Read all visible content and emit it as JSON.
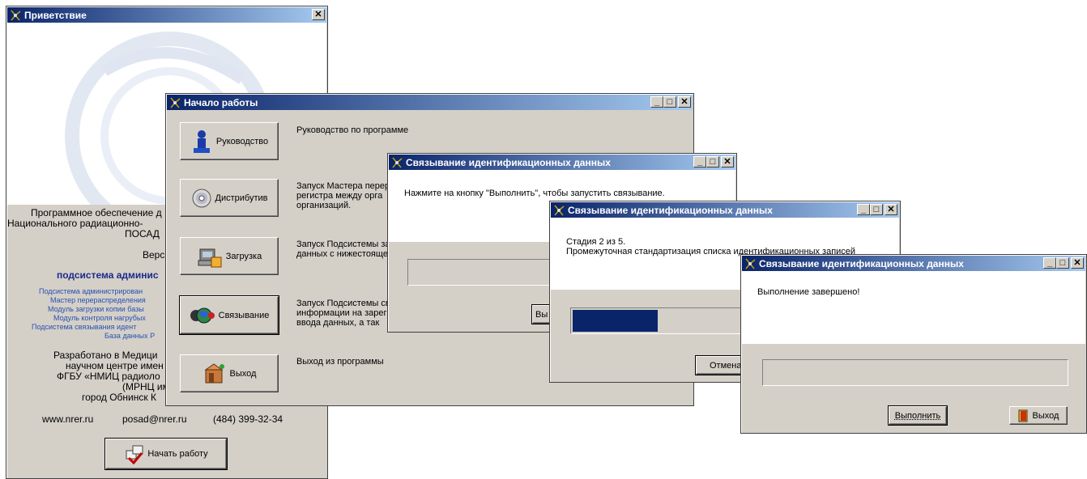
{
  "welcome": {
    "title": "Приветствие",
    "lines": [
      "Программное обеспечение д",
      "Национального радиационно-",
      "ПОСАД",
      "Верс"
    ],
    "subsystem": "подсистема админис",
    "modules": [
      "Подсистема администрирован",
      "Мастер перераспределения",
      "Модуль загрузки копии базы",
      "Модуль контроля нагрубых",
      "Подсистема связывания идент",
      "База данных Р"
    ],
    "dev_lines": [
      "Разработано в Медици",
      "научном центре имен",
      "ФГБУ «НМИЦ радиоло",
      "(МРНЦ им.",
      "город Обнинск К"
    ],
    "site": "www.nrer.ru",
    "email": "posad@nrer.ru",
    "phone": "(484) 399-32-34",
    "start_button": "Начать работу"
  },
  "start": {
    "title": "Начало работы",
    "items": [
      {
        "label": "Руководство",
        "desc": [
          "Руководство по программе"
        ]
      },
      {
        "label": "Дистрибутив",
        "desc": [
          "Запуск Мастера перер",
          "регистра между орга",
          "организаций."
        ]
      },
      {
        "label": "Загрузка",
        "desc": [
          "Запуск Подсистемы за",
          "данных с нижестояще"
        ]
      },
      {
        "label": "Связывание",
        "desc": [
          "Запуск Подсистемы св",
          "информации на зарег",
          "ввода данных, а так"
        ]
      },
      {
        "label": "Выход",
        "desc": [
          "Выход из программы"
        ]
      }
    ]
  },
  "link1": {
    "title": "Связывание идентификационных данных",
    "message": "Нажмите на кнопку \"Выполнить\", чтобы запустить связывание.",
    "button_partial": "Вы"
  },
  "link2": {
    "title": "Связывание идентификационных данных",
    "stage": "Стадия 2 из 5.",
    "message": "Промежуточная стандартизация списка идентификационных записей",
    "progress": 0.37,
    "cancel": "Отмена"
  },
  "link3": {
    "title": "Связывание идентификационных данных",
    "message": "Выполнение завершено!",
    "run": "Выполнить",
    "exit": "Выход"
  }
}
